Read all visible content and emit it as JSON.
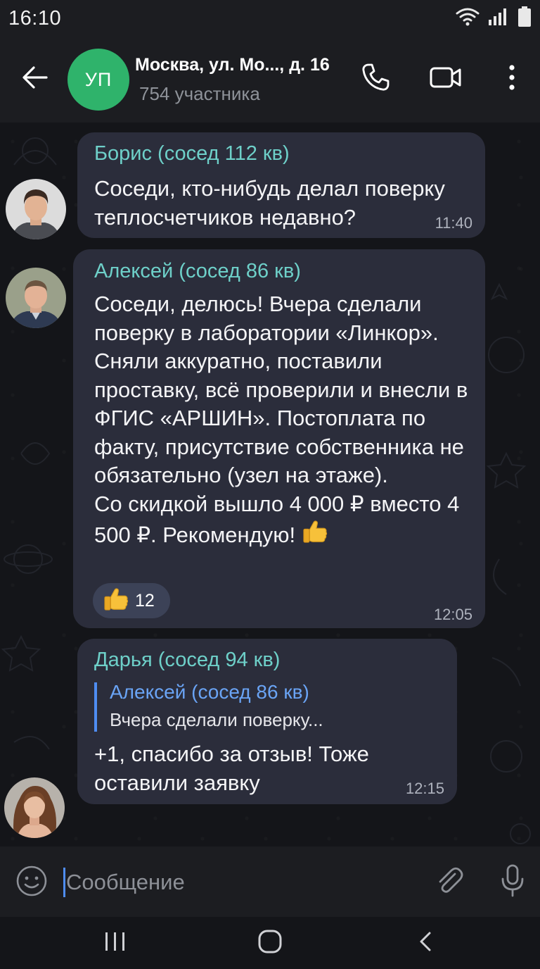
{
  "status_bar": {
    "time": "16:10"
  },
  "header": {
    "avatar_initials": "УП",
    "title": "Москва, ул. Мо..., д. 16",
    "subtitle": "754 участника"
  },
  "messages": [
    {
      "sender": "Борис (сосед 112 кв)",
      "text": "Соседи, кто-нибудь делал поверку теплосчетчиков недавно?",
      "time": "11:40"
    },
    {
      "sender": "Алексей  (сосед 86 кв)",
      "text": "Соседи, делюсь! Вчера сделали поверку в лаборатории «Линкор». Сняли аккуратно, поставили проставку, всё проверили и внесли в ФГИС «АРШИН». Постоплата по факту, присутствие собственника не обязательно (узел на этаже).\nСо скидкой вышло 4 000 ₽ вместо 4 500 ₽. Рекомендую!",
      "reaction_count": "12",
      "time": "12:05"
    },
    {
      "sender": "Дарья (сосед 94 кв)",
      "reply_author": "Алексей (сосед 86 кв)",
      "reply_text": "Вчера сделали поверку...",
      "text": "+1, спасибо за отзыв! Тоже оставили заявку",
      "time": "12:15"
    }
  ],
  "composer": {
    "placeholder": "Сообщение"
  },
  "colors": {
    "background": "#141519",
    "bar": "#1c1d21",
    "bubble": "#2b2d3b",
    "sender_name": "#6ed0c9",
    "reply_accent": "#4f8df2",
    "group_avatar": "#2fb36b"
  },
  "icons": {
    "status": [
      "wifi-icon",
      "signal-icon",
      "battery-icon"
    ],
    "header": [
      "back-arrow-icon",
      "phone-icon",
      "video-camera-icon",
      "more-vertical-icon"
    ],
    "composer": [
      "emoji-icon",
      "paperclip-icon",
      "microphone-icon"
    ],
    "navigation": [
      "recent-apps-icon",
      "home-icon",
      "nav-back-icon"
    ],
    "reaction": "thumbs-up-icon"
  }
}
